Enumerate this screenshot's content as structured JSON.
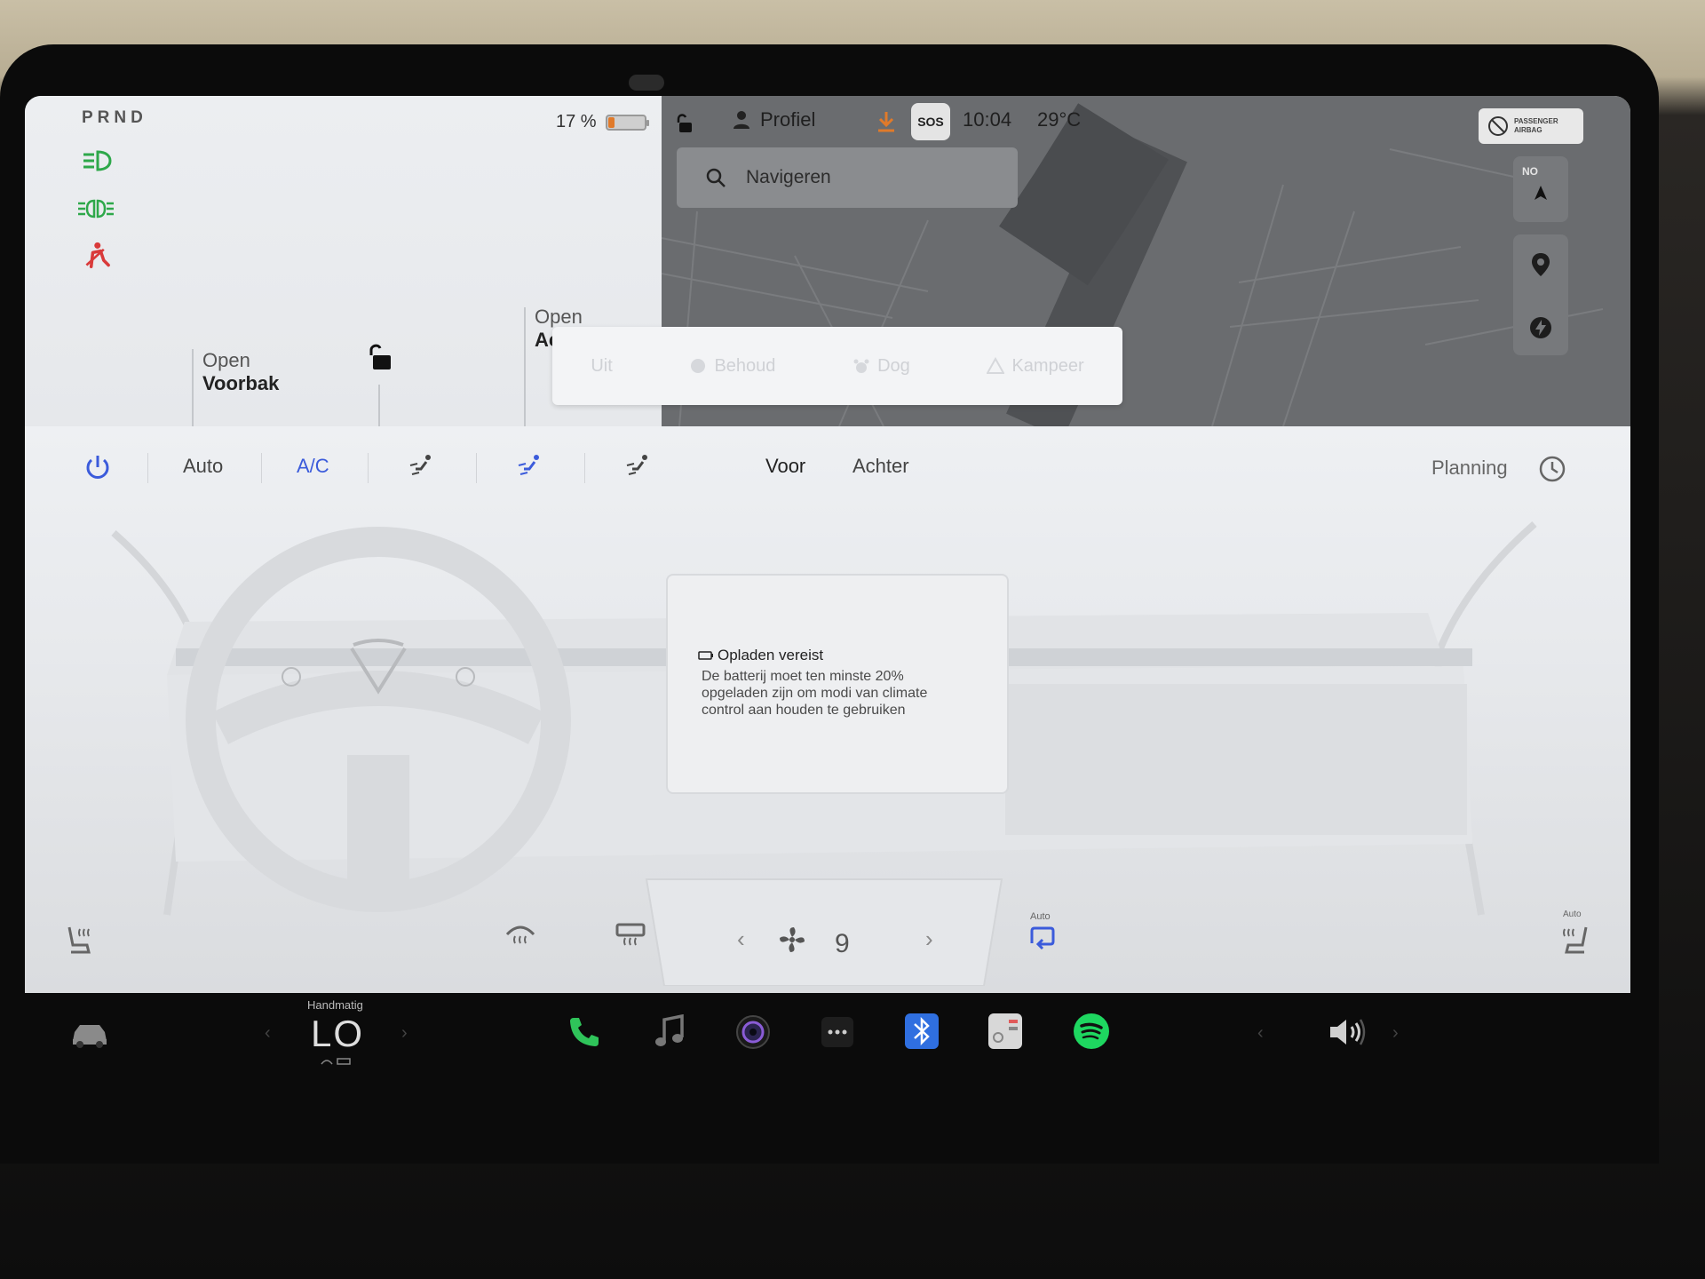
{
  "status": {
    "gear": "PRND",
    "battery_pct": "17 %",
    "battery_level": 0.17
  },
  "car": {
    "frunk_line1": "Open",
    "frunk_line2": "Voorbak",
    "trunk_line1": "Open",
    "trunk_line2": "Ac"
  },
  "topbar": {
    "profile": "Profiel",
    "sos": "SOS",
    "time": "10:04",
    "temp": "29°C"
  },
  "search": {
    "placeholder": "Navigeren"
  },
  "airbag": {
    "line1": "PASSENGER",
    "line2": "AIRBAG"
  },
  "map_compass": "NO",
  "climate_modes": [
    "Uit",
    "Behoud",
    "Dog",
    "Kampeer"
  ],
  "climate": {
    "auto": "Auto",
    "ac": "A/C",
    "front": "Voor",
    "rear": "Achter",
    "schedule": "Planning",
    "fan_speed": "9",
    "recirc_auto": "Auto",
    "seat_auto": "Auto"
  },
  "warning": {
    "title": "Opladen vereist",
    "body": "De batterij moet ten minste 20% opgeladen zijn om modi van climate control aan houden te gebruiken"
  },
  "dock": {
    "mode_label": "Handmatig",
    "temp_value": "LO"
  },
  "colors": {
    "accent_blue": "#3b5bdb",
    "battery_orange": "#e07a2a",
    "green_indicator": "#2ea84a",
    "seatbelt_red": "#d93a3a",
    "phone_green": "#2fc45a",
    "spotify_green": "#1ed760",
    "bluetooth_blue": "#2f6fe0"
  }
}
